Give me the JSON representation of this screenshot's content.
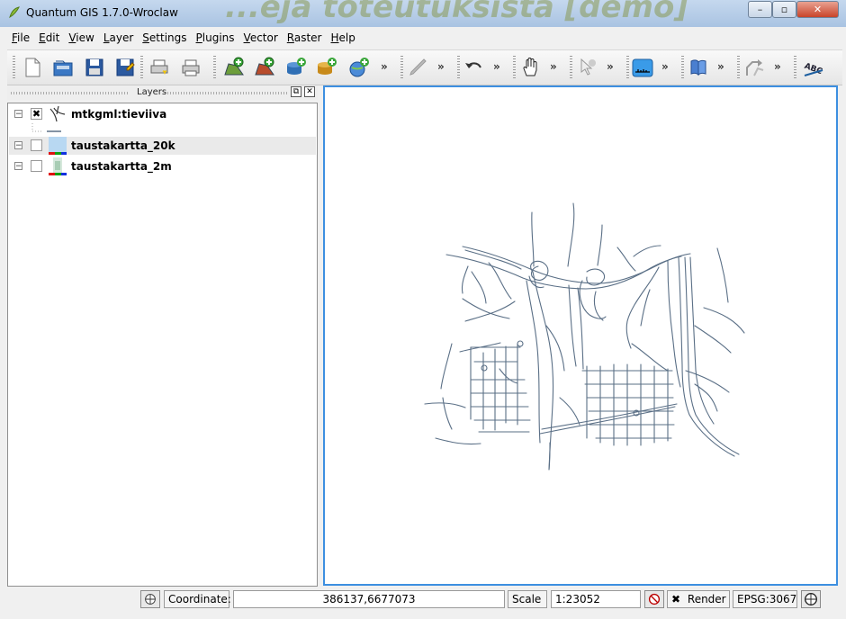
{
  "window": {
    "title": "Quantum GIS 1.7.0-Wroclaw",
    "watermark": "...eja toteutuksista [demo]"
  },
  "menu": [
    {
      "label": "File",
      "key": "F",
      "rest": "ile"
    },
    {
      "label": "Edit",
      "key": "E",
      "rest": "dit"
    },
    {
      "label": "View",
      "key": "V",
      "rest": "iew"
    },
    {
      "label": "Layer",
      "key": "L",
      "rest": "ayer"
    },
    {
      "label": "Settings",
      "key": "S",
      "rest": "ettings"
    },
    {
      "label": "Plugins",
      "key": "P",
      "rest": "lugins"
    },
    {
      "label": "Vector",
      "key": "V",
      "rest": "ector"
    },
    {
      "label": "Raster",
      "key": "R",
      "rest": "aster"
    },
    {
      "label": "Help",
      "key": "H",
      "rest": "elp"
    }
  ],
  "toolbar": {
    "more": "»",
    "buttons": [
      "new-project-icon",
      "open-project-icon",
      "save-project-icon",
      "save-as-icon",
      "new-print-composer-icon",
      "print-icon",
      "add-vector-layer-icon",
      "add-raster-layer-icon",
      "add-postgis-layer-icon",
      "add-spatialite-layer-icon",
      "add-wms-layer-icon",
      "toggle-editing-icon",
      "undo-icon",
      "pan-icon",
      "identify-icon",
      "measure-icon",
      "help-icon",
      "gps-icon",
      "label-icon"
    ]
  },
  "layers_panel": {
    "title": "Layers",
    "layers": [
      {
        "name": "mtkgml:tieviiva",
        "checked": true,
        "expand": "⊟",
        "check_mark": "✖",
        "type": "vector-line"
      },
      {
        "name": "taustakartta_20k",
        "checked": false,
        "expand": "⊟",
        "check_mark": "",
        "type": "raster"
      },
      {
        "name": "taustakartta_2m",
        "checked": false,
        "expand": "⊟",
        "check_mark": "",
        "type": "raster"
      }
    ]
  },
  "map": {
    "line_color": "#5a6f86",
    "background": "#ffffff"
  },
  "status": {
    "coordinate_label": "Coordinate:",
    "coordinate_value": "386137,6677073",
    "scale_label": "Scale",
    "scale_value": "1:23052",
    "render_label": "Render",
    "render_check": "✖",
    "crs": "EPSG:3067"
  },
  "colors": {
    "accent": "#3d8fe0",
    "road": "#5a6f86"
  }
}
